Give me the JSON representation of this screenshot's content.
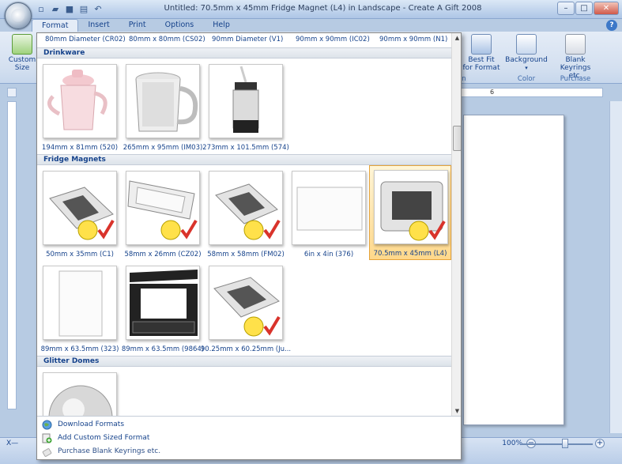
{
  "window": {
    "title": "Untitled: 70.5mm x 45mm Fridge Magnet (L4) in Landscape - Create A Gift 2008"
  },
  "qat": [
    "new-icon",
    "open-icon",
    "save-icon",
    "print-icon",
    "undo-icon"
  ],
  "window_controls": {
    "minimize": "–",
    "maximize": "□",
    "close": "✕"
  },
  "tabs": [
    {
      "label": "Format",
      "active": true
    },
    {
      "label": "Insert"
    },
    {
      "label": "Print"
    },
    {
      "label": "Options"
    },
    {
      "label": "Help"
    }
  ],
  "help_glyph": "?",
  "ribbon": {
    "custom_size": "Custom Size",
    "best_fit": "Best Fit for Format",
    "background": "Background",
    "blank_keyrings": "Blank Keyrings etc.",
    "group_color": "Color",
    "group_purchase": "Purchase",
    "group_partial": "n"
  },
  "ruler": {
    "tick6": "6"
  },
  "top_captions": [
    "80mm Diameter (CR02)",
    "80mm x 80mm (CS02)",
    "90mm Diameter (V1)",
    "90mm x 90mm (IC02)",
    "90mm x 90mm (N1)"
  ],
  "sections": {
    "drinkware": "Drinkware",
    "fridge_magnets": "Fridge Magnets",
    "glitter_domes": "Glitter Domes"
  },
  "drinkware_items": [
    "194mm x 81mm (520)",
    "265mm x 95mm (IM03)",
    "273mm x 101.5mm (574)"
  ],
  "fridge_items_row1": [
    "50mm x 35mm (C1)",
    "58mm x 26mm (CZ02)",
    "58mm x 58mm (FM02)",
    "6in x 4in (376)",
    "70.5mm x 45mm (L4)"
  ],
  "fridge_items_row2": [
    "89mm x 63.5mm (323)",
    "89mm x 63.5mm (9864)",
    "90.25mm x 60.25mm (Ju..."
  ],
  "menu": {
    "download": "Download Formats",
    "add_custom": "Add Custom Sized Format",
    "purchase": "Purchase Blank Keyrings etc."
  },
  "status": {
    "zoom": "100%",
    "x_label": "X—"
  },
  "colors": {
    "accent": "#15428b",
    "selected": "#ffd88a"
  }
}
